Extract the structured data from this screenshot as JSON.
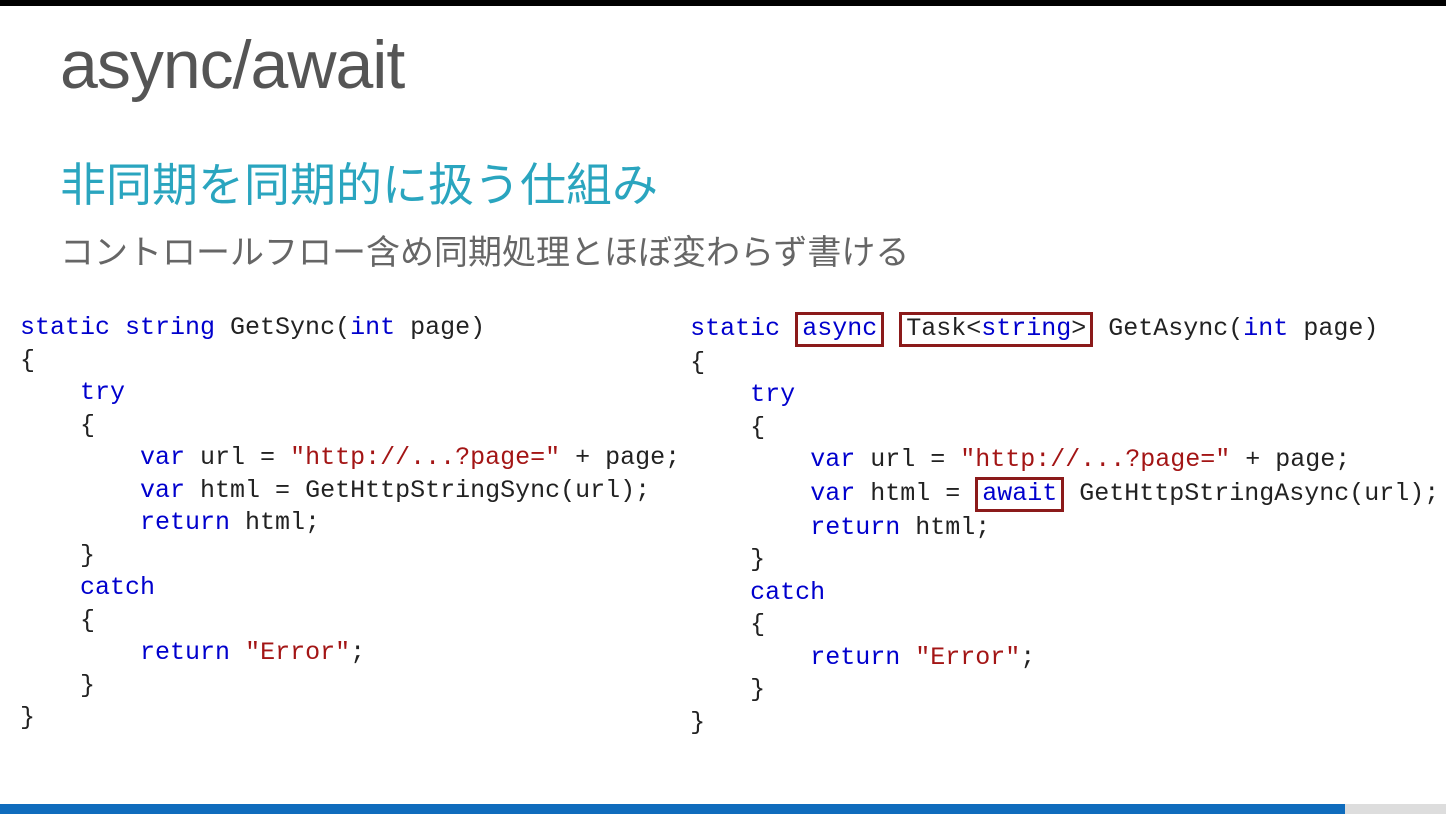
{
  "title": "async/await",
  "subtitle_cyan": "非同期を同期的に扱う仕組み",
  "subtitle_gray": "コントロールフロー含め同期処理とほぼ変わらず書ける",
  "code_left": {
    "l1_kw1": "static",
    "l1_kw2": "string",
    "l1_text1": " GetSync(",
    "l1_kw3": "int",
    "l1_text2": " page)",
    "l2": "{",
    "l3_kw": "try",
    "l4": "    {",
    "l5_kw": "var",
    "l5_text1": " url = ",
    "l5_str": "\"http://...?page=\"",
    "l5_text2": " + page;",
    "l6_kw": "var",
    "l6_text": " html = GetHttpStringSync(url);",
    "l7_kw": "return",
    "l7_text": " html;",
    "l8": "    }",
    "l9_kw": "catch",
    "l10": "    {",
    "l11_kw": "return",
    "l11_str": "\"Error\"",
    "l11_text": ";",
    "l12": "    }",
    "l13": "}"
  },
  "code_right": {
    "l1_kw1": "static",
    "l1_box1_kw": "async",
    "l1_box2_text1": "Task<",
    "l1_box2_kw": "string",
    "l1_box2_text2": ">",
    "l1_text1": " GetAsync(",
    "l1_kw3": "int",
    "l1_text2": " page)",
    "l2": "{",
    "l3_kw": "try",
    "l4": "    {",
    "l5_kw": "var",
    "l5_text1": " url = ",
    "l5_str": "\"http://...?page=\"",
    "l5_text2": " + page;",
    "l6_kw": "var",
    "l6_text1": " html = ",
    "l6_box_kw": "await",
    "l6_text2": " GetHttpStringAsync(url);",
    "l7_kw": "return",
    "l7_text": " html;",
    "l8": "    }",
    "l9_kw": "catch",
    "l10": "    {",
    "l11_kw": "return",
    "l11_str": "\"Error\"",
    "l11_text": ";",
    "l12": "    }",
    "l13": "}"
  }
}
